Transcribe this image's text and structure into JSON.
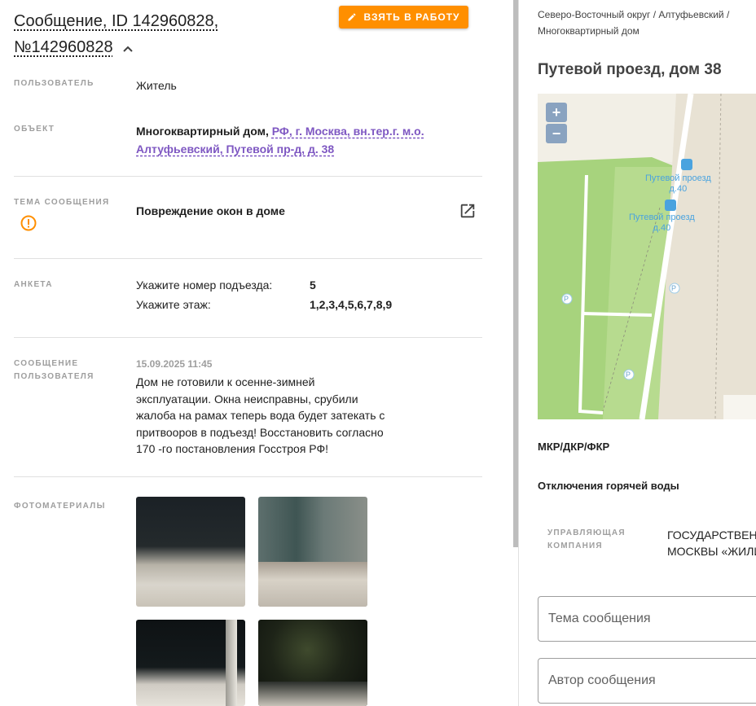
{
  "header": {
    "title_line1": "Сообщение, ID 142960828,",
    "title_line2": "№142960828",
    "take_button": "ВЗЯТЬ В РАБОТУ"
  },
  "details": {
    "user_label": "ПОЛЬЗОВАТЕЛЬ",
    "user_value": "Житель",
    "object_label": "ОБЪЕКТ",
    "object_type": "Многоквартирный дом,",
    "object_link_line1": "РФ, г. Москва, вн.тер.г. м.о.",
    "object_link_line2": "Алтуфьевский, Путевой пр-д, д. 38",
    "topic_label": "ТЕМА СООБЩЕНИЯ",
    "topic_value": "Повреждение окон в доме",
    "survey_label": "АНКЕТА",
    "survey": [
      {
        "question": "Укажите номер подъезда:",
        "answer": "5"
      },
      {
        "question": "Укажите этаж:",
        "answer": "1,2,3,4,5,6,7,8,9"
      }
    ],
    "message_label_line1": "СООБЩЕНИЕ",
    "message_label_line2": "ПОЛЬЗОВАТЕЛЯ",
    "message_date": "15.09.2025 11:45",
    "message_lines": [
      "Дом не готовили к осенне-зимней",
      "эксплуатации. Окна неисправны, срубили",
      "жалоба на рамах теперь вода будет затекать с",
      "притвооров в подъезд! Восстановить согласно",
      "170 -го постановления Госстроя РФ!"
    ],
    "photos_label": "ФОТОМАТЕРИАЛЫ"
  },
  "sidebar": {
    "breadcrumb_line1": "Северо-Восточный округ / Алтуфьевский /",
    "breadcrumb_line2": "Многоквартирный дом",
    "address": "Путевой проезд, дом 38",
    "map": {
      "zoom_in": "+",
      "zoom_out": "−",
      "stop1_line1": "Путевой проезд",
      "stop1_line2": "д.40",
      "stop2_line1": "Путевой проезд",
      "stop2_line2": "д.40",
      "parking": "P"
    },
    "program": "МКР/ДКР/ФКР",
    "outage": "Отключения горячей воды",
    "uk_label_line1": "УПРАВЛЯЮЩАЯ",
    "uk_label_line2": "КОМПАНИЯ",
    "uk_value_line1": "ГОСУДАРСТВЕНН",
    "uk_value_line2": "МОСКВЫ «ЖИЛИ",
    "topic_placeholder": "Тема сообщения",
    "author_placeholder": "Автор сообщения"
  },
  "colors": {
    "accent": "#ff8f00",
    "link": "#7e57c2",
    "map_green": "#a7d37d"
  }
}
